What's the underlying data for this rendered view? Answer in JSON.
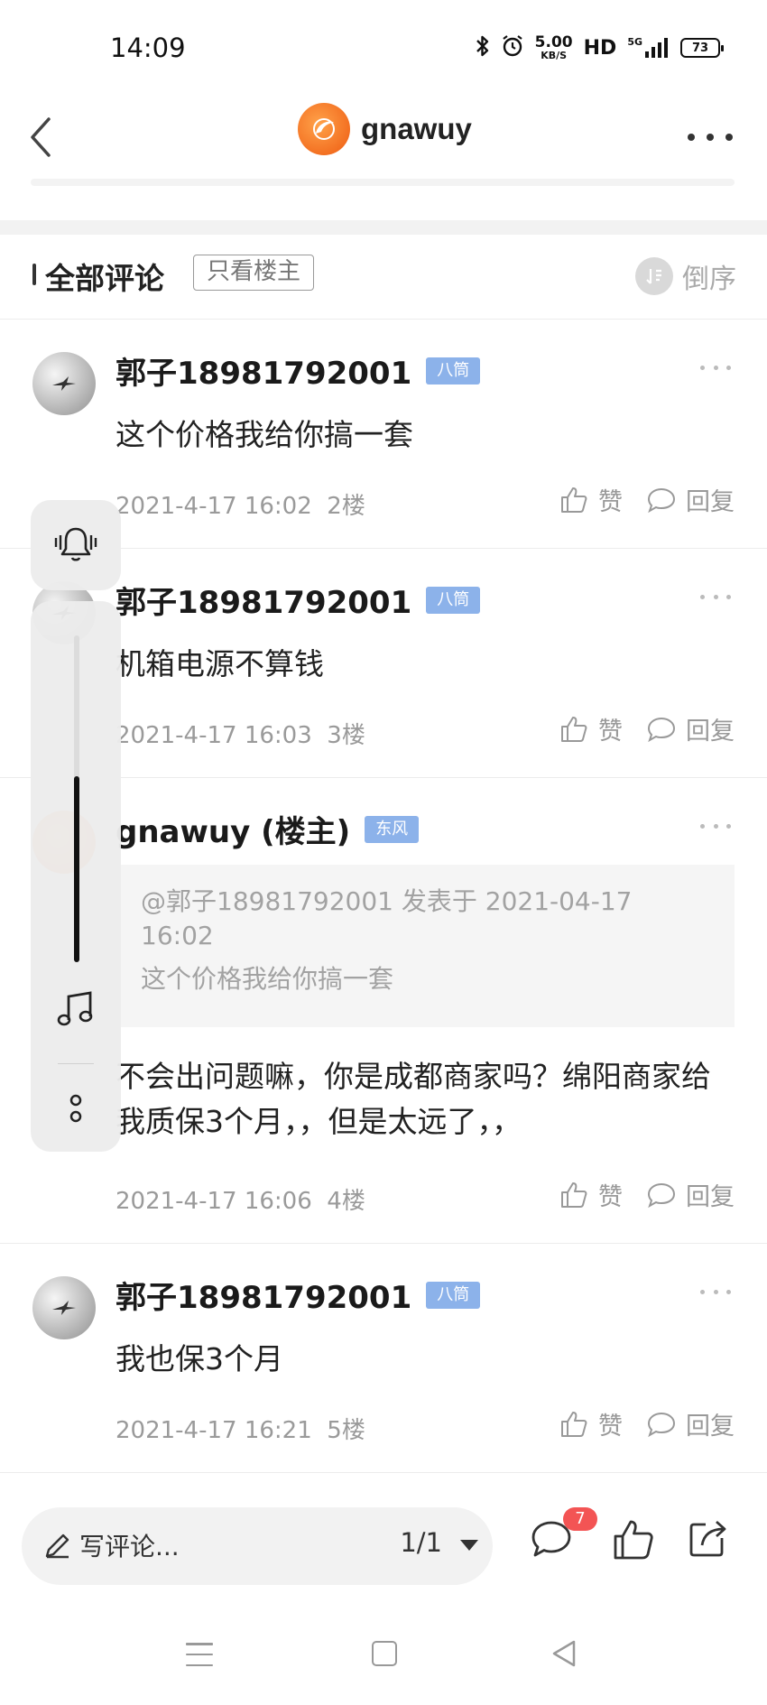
{
  "status_bar": {
    "time": "14:09",
    "speed_value": "5.00",
    "speed_unit": "KB/S",
    "hd": "HD",
    "network": "5G",
    "battery": "73",
    "icons": [
      "bluetooth-icon",
      "alarm-icon",
      "signal-icon",
      "battery-icon"
    ]
  },
  "header": {
    "title": "gnawuy"
  },
  "comments_header": {
    "title": "全部评论",
    "filter_label": "只看楼主",
    "sort_label": "倒序"
  },
  "comments": [
    {
      "username": "郭子18981792001",
      "badge": "八筒",
      "text": "这个价格我给你搞一套",
      "date": "2021-4-17 16:02",
      "floor": "2楼",
      "like_label": "赞",
      "reply_label": "回复"
    },
    {
      "username": "郭子18981792001",
      "badge": "八筒",
      "text": "机箱电源不算钱",
      "date": "2021-4-17 16:03",
      "floor": "3楼",
      "like_label": "赞",
      "reply_label": "回复"
    },
    {
      "username": "gnawuy (楼主)",
      "badge": "东风",
      "quote_header": "@郭子18981792001 发表于 2021-04-17 16:02",
      "quote_text": "这个价格我给你搞一套",
      "text": "不会出问题嘛，你是成都商家吗？绵阳商家给我质保3个月，，但是太远了，，",
      "date": "2021-4-17 16:06",
      "floor": "4楼",
      "like_label": "赞",
      "reply_label": "回复"
    },
    {
      "username": "郭子18981792001",
      "badge": "八筒",
      "text": "我也保3个月",
      "date": "2021-4-17 16:21",
      "floor": "5楼",
      "like_label": "赞",
      "reply_label": "回复"
    }
  ],
  "bottom_bar": {
    "input_placeholder": "写评论...",
    "page": "1/1",
    "comment_count": "7"
  },
  "colors": {
    "badge_blue": "#8cb2ea",
    "accent_orange": "#f06a28",
    "notification_red": "#f35454"
  }
}
